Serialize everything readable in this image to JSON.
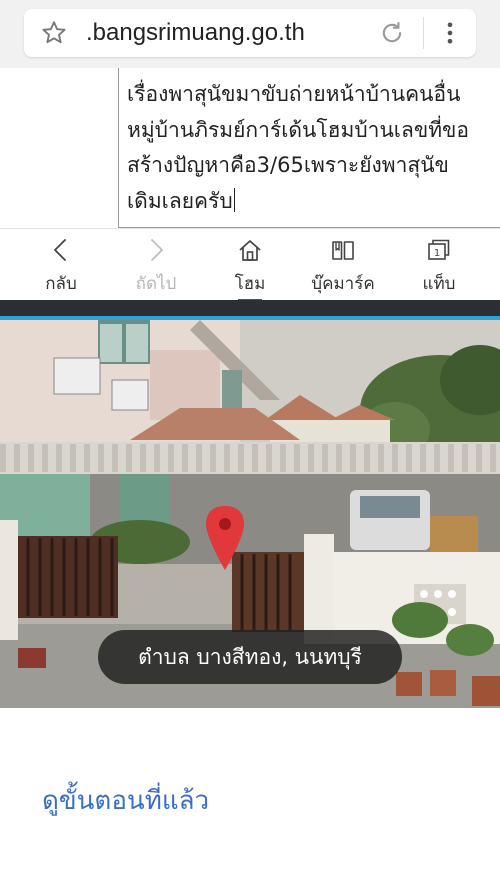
{
  "browser": {
    "url": ".bangsrimuang.go.th",
    "icons": [
      "star-icon",
      "reload-icon",
      "more-vertical-icon"
    ]
  },
  "textarea": {
    "lines": [
      "เรื่องพาสุนัขมาขับถ่ายหน้าบ้านคนอื่น",
      "หมู่บ้านภิรมย์การ์เด้นโฮมบ้านเลขที่ขอ",
      "สร้างปัญหาคือ3/65เพราะยังพาสุนัข",
      "เดิมเลยครับ"
    ]
  },
  "nav": {
    "back_label": "กลับ",
    "forward_label": "ถัดไป",
    "home_label": "โฮม",
    "bookmarks_label": "บุ๊คมาร์ค",
    "tabs_label": "แท็บ",
    "tabs_count": "1"
  },
  "street_view": {
    "location": "ตำบล บางสีทอง, นนทบุรี",
    "pin_color": "#e0383b"
  },
  "footer": {
    "prev_step_link": "ดูขั้นตอนที่แล้ว"
  },
  "colors": {
    "accent": "#2fa3d6",
    "link": "#3a6fc4"
  }
}
